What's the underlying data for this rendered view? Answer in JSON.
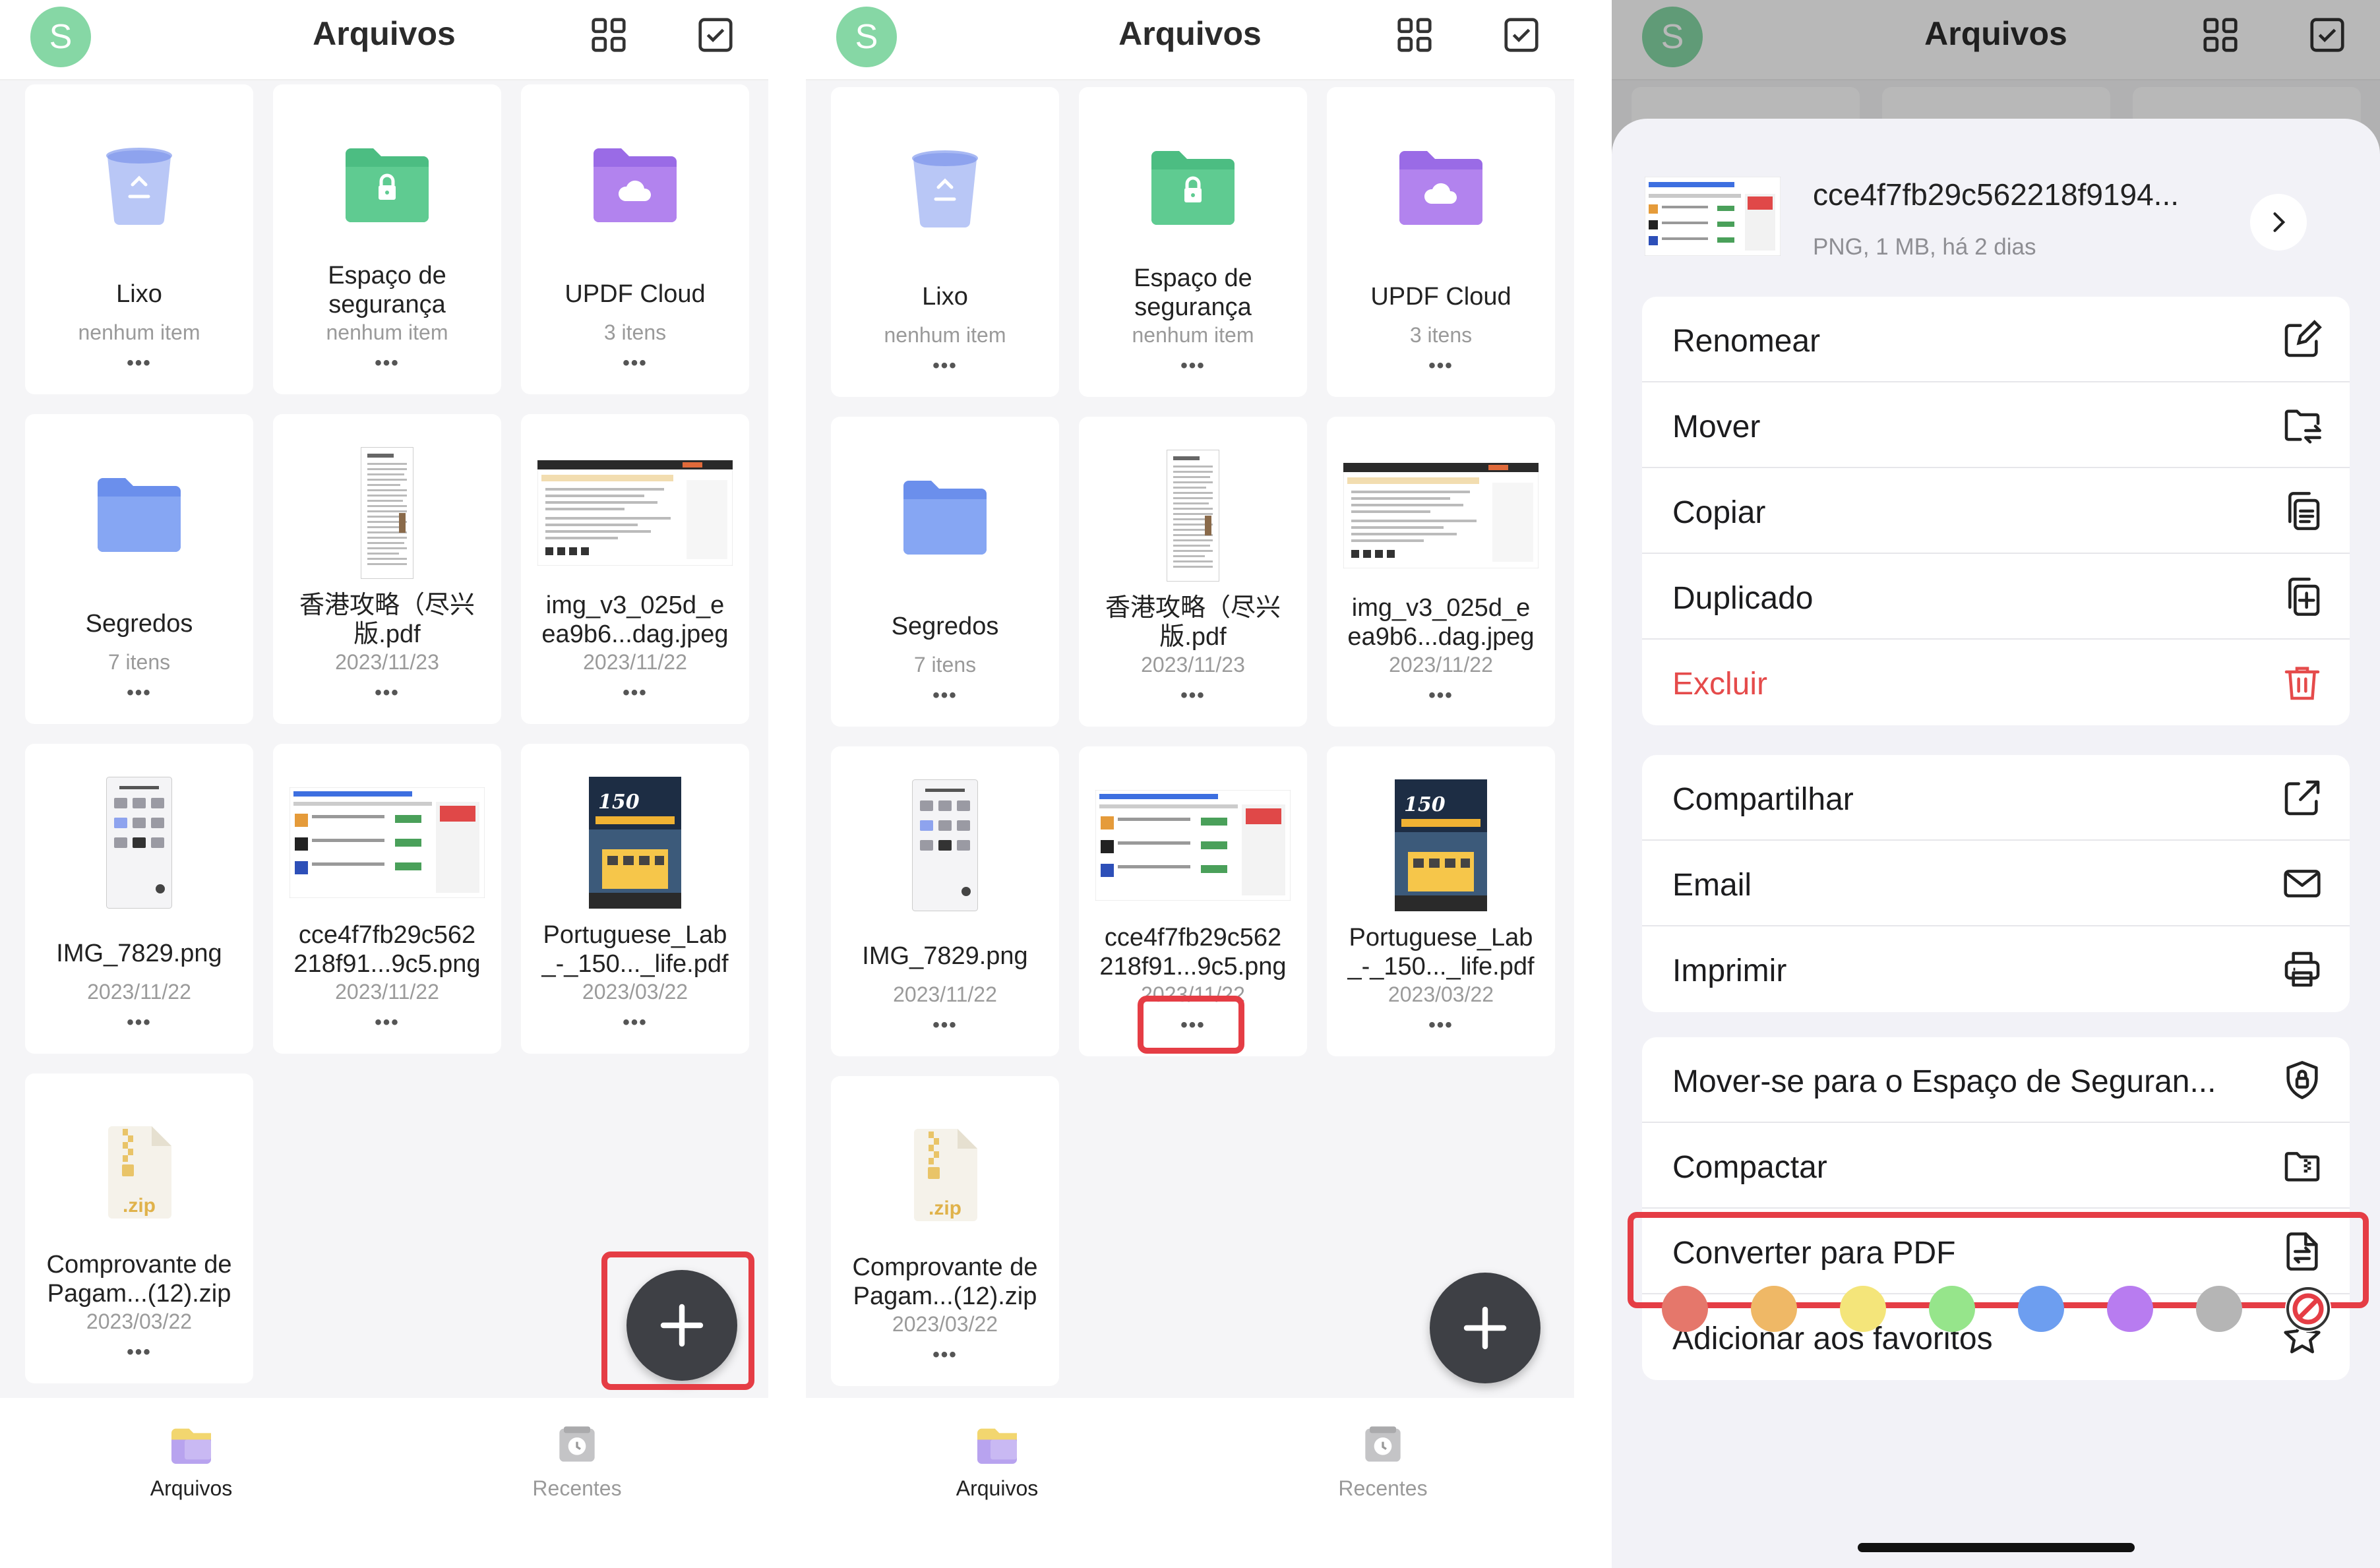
{
  "header": {
    "avatar_letter": "S",
    "title": "Arquivos"
  },
  "cards": [
    {
      "name": "Lixo",
      "meta": "nenhum item",
      "kind": "trash-icon"
    },
    {
      "name": "Espaço de\nsegurança",
      "meta": "nenhum item",
      "kind": "locked-folder-icon"
    },
    {
      "name": "UPDF Cloud",
      "meta": "3 itens",
      "kind": "cloud-folder-icon"
    },
    {
      "name": "Segredos",
      "meta": "7 itens",
      "kind": "folder-icon"
    },
    {
      "name": "香港攻略（尽兴\n版.pdf",
      "meta": "2023/11/23",
      "kind": "pdf-thumbnail"
    },
    {
      "name": "img_v3_025d_e\nea9b6...dag.jpeg",
      "meta": "2023/11/22",
      "kind": "jpeg-thumbnail"
    },
    {
      "name": "IMG_7829.png",
      "meta": "2023/11/22",
      "kind": "phone-screenshot-thumbnail"
    },
    {
      "name": "cce4f7fb29c562\n218f91...9c5.png",
      "meta": "2023/11/22",
      "kind": "png-thumbnail"
    },
    {
      "name": "Portuguese_Lab\n_-_150..._life.pdf",
      "meta": "2023/03/22",
      "kind": "book-cover-thumbnail"
    },
    {
      "name": "Comprovante de\nPagam...(12).zip",
      "meta": "2023/03/22",
      "kind": "zip-icon"
    }
  ],
  "card_more": "•••",
  "zip_ext": ".zip",
  "nav": {
    "files_label": "Arquivos",
    "recent_label": "Recentes"
  },
  "sheet": {
    "file_name": "cce4f7fb29c562218f9194...",
    "file_meta": "PNG, 1 MB, há 2 dias",
    "group1": [
      "Renomear",
      "Mover",
      "Copiar",
      "Duplicado",
      "Excluir"
    ],
    "group2": [
      "Compartilhar",
      "Email",
      "Imprimir"
    ],
    "group3": [
      "Mover-se para o Espaço de Seguran...",
      "Compactar",
      "Converter para PDF",
      "Adicionar aos favoritos"
    ],
    "tag_colors": [
      "#e5776b",
      "#efb866",
      "#f4e57a",
      "#96e58b",
      "#6d9ef0",
      "#b87cf0",
      "#b5b5b5"
    ]
  },
  "colors": {
    "highlight": "#e53d45",
    "nav_active": "#222222",
    "nav_inactive": "#9a9a9a",
    "danger": "#e54b4b",
    "avatar": "#86d7a5"
  }
}
